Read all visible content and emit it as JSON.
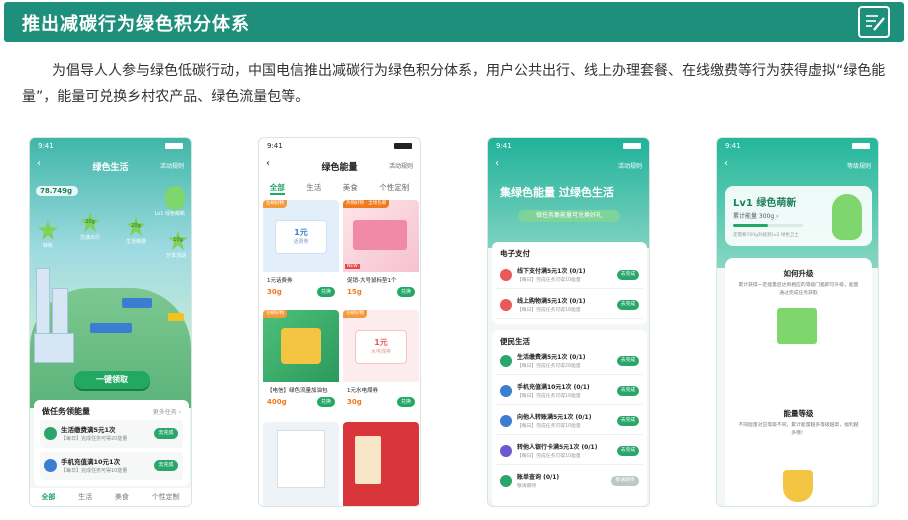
{
  "header": {
    "title": "推出减碳行为绿色积分体系",
    "icon": "edit-note-icon"
  },
  "intro": "为倡导人人参与绿色低碳行动，中国电信推出减碳行为绿色积分体系，用户公共出行、线上办理套餐、在线缴费等行为获得虚拟“绿色能量”，能量可兑换乡村农产品、绿色流量包等。",
  "colors": {
    "brand": "#1e8f7a",
    "accent": "#23a863",
    "price": "#f07a1e"
  },
  "phone1": {
    "time": "9:41",
    "title": "绿色生活",
    "rule": "活动规则",
    "energy": "78.749g",
    "level": "Lv1 绿色萌新",
    "bubbles": [
      {
        "label": "转账",
        "value": ""
      },
      {
        "label": "交通出行",
        "value": "20g"
      },
      {
        "label": "生活缴费",
        "value": "20g"
      },
      {
        "label": "分享活动",
        "value": "10g"
      }
    ],
    "claim": "一键领取",
    "task_head": "做任务领能量",
    "task_more": "更多任务 ›",
    "tasks": [
      {
        "name": "生活缴费满5元1次",
        "sub": "【每日】完成任务可得20能量",
        "btn": "去完成"
      },
      {
        "name": "手机充值满10元1次",
        "sub": "【每日】完成任务可得10能量",
        "btn": "去完成"
      }
    ],
    "tabs": [
      "全部",
      "生活",
      "美食",
      "个性定制"
    ]
  },
  "phone2": {
    "time": "9:41",
    "title": "绿色能量",
    "rule": "活动规则",
    "tabs": [
      "全部",
      "生活",
      "美食",
      "个性定制"
    ],
    "goods": [
      {
        "tag": "包邮好物",
        "name": "1元话费券",
        "price": "30g",
        "btn": "兑换",
        "coupon": "1元",
        "coupon_sub": "话费券"
      },
      {
        "tag": "热销好物 · 全场包邮",
        "name": "促销-大号鼠标垫1个",
        "price": "15g",
        "btn": "兑换",
        "badge": "NEW"
      },
      {
        "tag": "包邮好物",
        "name": "【电信】绿色流量加油包",
        "price": "400g",
        "btn": "兑换"
      },
      {
        "tag": "包邮好物",
        "name": "1元水电煤券",
        "price": "30g",
        "btn": "兑换",
        "coupon": "1元",
        "coupon_sub": "水电煤券"
      }
    ]
  },
  "phone3": {
    "time": "9:41",
    "rule": "活动规则",
    "hero_title": "集绿色能量 过绿色生活",
    "hero_sub": "做任务集能量可兑换好礼",
    "sections": [
      {
        "title": "电子支付",
        "rows": [
          {
            "name": "线下支付满5元1次 (0/1)",
            "sub": "【每日】完成任务可得10能量",
            "btn": "去完成",
            "color": "#e85a5a"
          },
          {
            "name": "线上购物满5元1次 (0/1)",
            "sub": "【每日】完成任务可得10能量",
            "btn": "去完成",
            "color": "#e85a5a"
          }
        ]
      },
      {
        "title": "便民生活",
        "rows": [
          {
            "name": "生活缴费满5元1次 (0/1)",
            "sub": "【每日】完成任务可得20能量",
            "btn": "去完成",
            "color": "#2aa66b"
          },
          {
            "name": "手机充值满10元1次 (0/1)",
            "sub": "【每日】完成任务可得10能量",
            "btn": "去完成",
            "color": "#3a7dd1"
          },
          {
            "name": "向他人转账满5元1次 (0/1)",
            "sub": "【每日】完成任务可得10能量",
            "btn": "去完成",
            "color": "#3a7dd1"
          },
          {
            "name": "转他人银行卡满5元1次 (0/1)",
            "sub": "【每日】完成任务可得10能量",
            "btn": "去完成",
            "color": "#6a5ad1"
          },
          {
            "name": "账单查询 (0/1)",
            "sub": "敬请期待",
            "btn": "敬请期待",
            "color": "#2aa66b",
            "disabled": true
          }
        ]
      }
    ]
  },
  "phone4": {
    "time": "9:41",
    "rule": "等级规则",
    "level_title": "Lv1 绿色萌新",
    "level_energy": "累计能量 300g ›",
    "level_progress": 0.5,
    "level_note": "还需要700g升级到Lv2 绿色卫士",
    "upgrade_title": "如何升级",
    "upgrade_text": "累计获得一定能量后达到相应的等级门槛即可升级，能量通过完成任务获取",
    "grade_title": "能量等级",
    "grade_text": "不同能量对应等级不同，累计能量越多等级越高，福利越多哦！"
  }
}
